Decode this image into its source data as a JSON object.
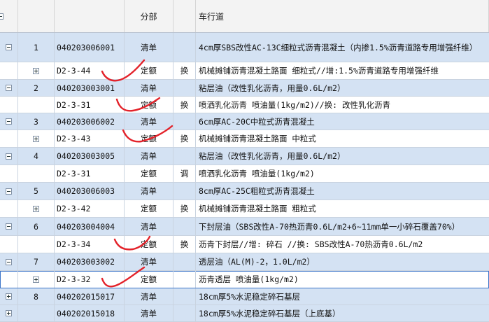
{
  "header": {
    "col_type": "分部",
    "col_name": "车行道"
  },
  "rows": [
    {
      "kind": "list",
      "num": "1",
      "code": "040203006001",
      "type": "清单",
      "flag": "",
      "name": "4cm厚SBS改性AC-13C细粒式沥青混凝土（内掺1.5%沥青道路专用增强纤维）"
    },
    {
      "kind": "quota",
      "num": "",
      "code": "D2-3-44",
      "type": "定额",
      "flag": "换",
      "name": "机械摊铺沥青混凝土路面 细粒式//增:1.5%沥青道路专用增强纤维"
    },
    {
      "kind": "list",
      "num": "2",
      "code": "040203003001",
      "type": "清单",
      "flag": "",
      "name": "粘层油（改性乳化沥青，用量0.6L/m2）"
    },
    {
      "kind": "quota",
      "num": "",
      "code": "D2-3-31",
      "type": "定额",
      "flag": "换",
      "name": "喷洒乳化沥青 喷油量(1kg/m2)//换: 改性乳化沥青"
    },
    {
      "kind": "list",
      "num": "3",
      "code": "040203006002",
      "type": "清单",
      "flag": "",
      "name": "6cm厚AC-20C中粒式沥青混凝土"
    },
    {
      "kind": "quota",
      "num": "",
      "code": "D2-3-43",
      "type": "定额",
      "flag": "换",
      "name": "机械摊铺沥青混凝土路面 中粒式"
    },
    {
      "kind": "list",
      "num": "4",
      "code": "040203003005",
      "type": "清单",
      "flag": "",
      "name": "粘层油（改性乳化沥青，用量0.6L/m2）"
    },
    {
      "kind": "quota",
      "num": "",
      "code": "D2-3-31",
      "type": "定额",
      "flag": "调",
      "name": "喷洒乳化沥青 喷油量(1kg/m2)"
    },
    {
      "kind": "list",
      "num": "5",
      "code": "040203006003",
      "type": "清单",
      "flag": "",
      "name": "8cm厚AC-25C粗粒式沥青混凝土"
    },
    {
      "kind": "quota",
      "num": "",
      "code": "D2-3-42",
      "type": "定额",
      "flag": "换",
      "name": "机械摊铺沥青混凝土路面 粗粒式"
    },
    {
      "kind": "list",
      "num": "6",
      "code": "040203004004",
      "type": "清单",
      "flag": "",
      "name": "下封层油（SBS改性A-70热沥青0.6L/m2+6~11mm单一小碎石覆盖70%）"
    },
    {
      "kind": "quota",
      "num": "",
      "code": "D2-3-34",
      "type": "定额",
      "flag": "换",
      "name": "沥青下封层//增: 碎石 //换: SBS改性A-70热沥青0.6L/m2"
    },
    {
      "kind": "list",
      "num": "7",
      "code": "040203003002",
      "type": "清单",
      "flag": "",
      "name": "透层油（AL(M)-2，1.0L/m2）"
    },
    {
      "kind": "quota",
      "num": "",
      "code": "D2-3-32",
      "type": "定额",
      "flag": "",
      "name": "沥青透层 喷油量(1kg/m2)"
    },
    {
      "kind": "list",
      "num": "8",
      "code": "040202015017",
      "type": "清单",
      "flag": "",
      "name": "18cm厚5%水泥稳定碎石基层"
    },
    {
      "kind": "list",
      "num": "",
      "code": "040202015018",
      "type": "清单",
      "flag": "",
      "name": "18cm厚5%水泥稳定碎石基层（上底基）"
    }
  ],
  "annotation": {
    "color": "#e3222a"
  }
}
